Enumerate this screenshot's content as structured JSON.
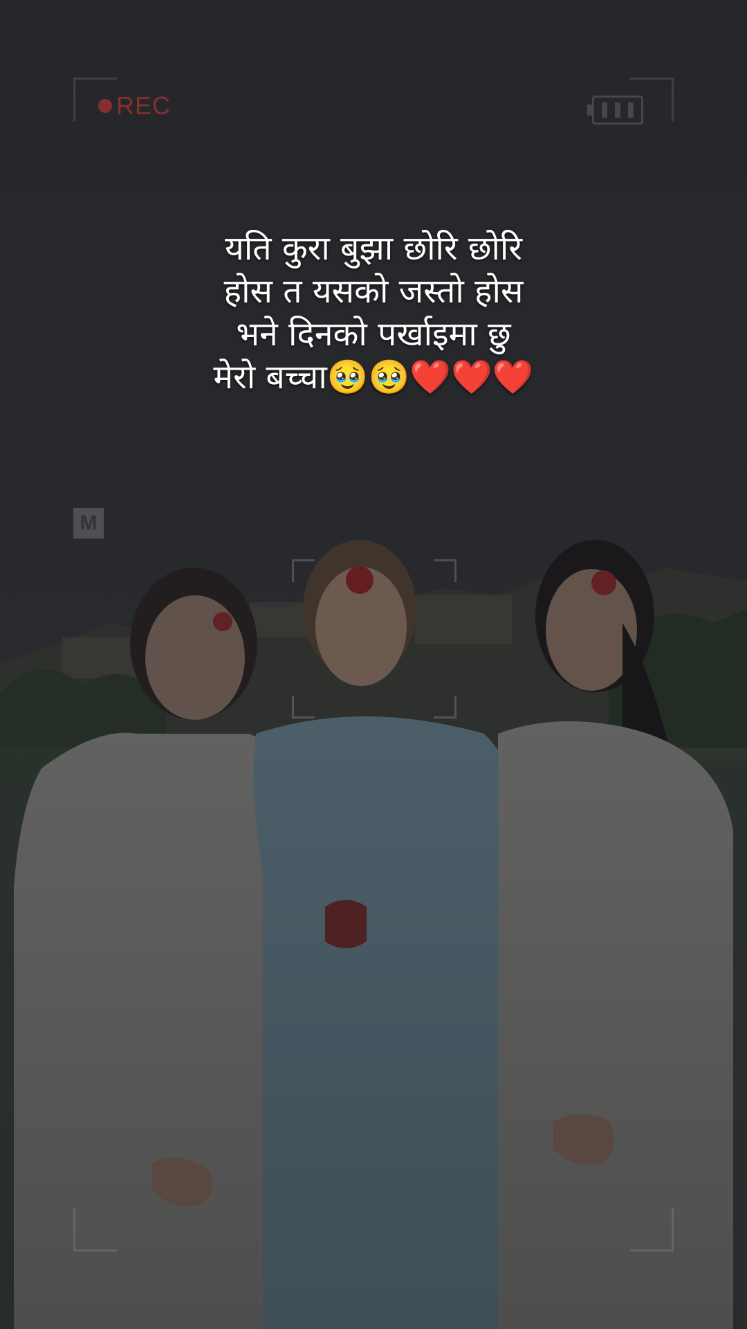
{
  "viewfinder": {
    "rec_label": "REC",
    "mode_label": "M"
  },
  "caption": {
    "lines": [
      "यति कुरा बुझा छोरि  छोरि",
      "होस त यसको जस्तो होस",
      "भने दिनको पर्खाइमा छु",
      "मेरो बच्चा🥹🥹❤️❤️❤️"
    ]
  },
  "colors": {
    "caption_text": "#ffffff",
    "rec_red": "#aa3232",
    "sky": "#34363a"
  },
  "icons": {
    "rec_indicator": "rec-dot-icon",
    "battery": "battery-icon"
  }
}
